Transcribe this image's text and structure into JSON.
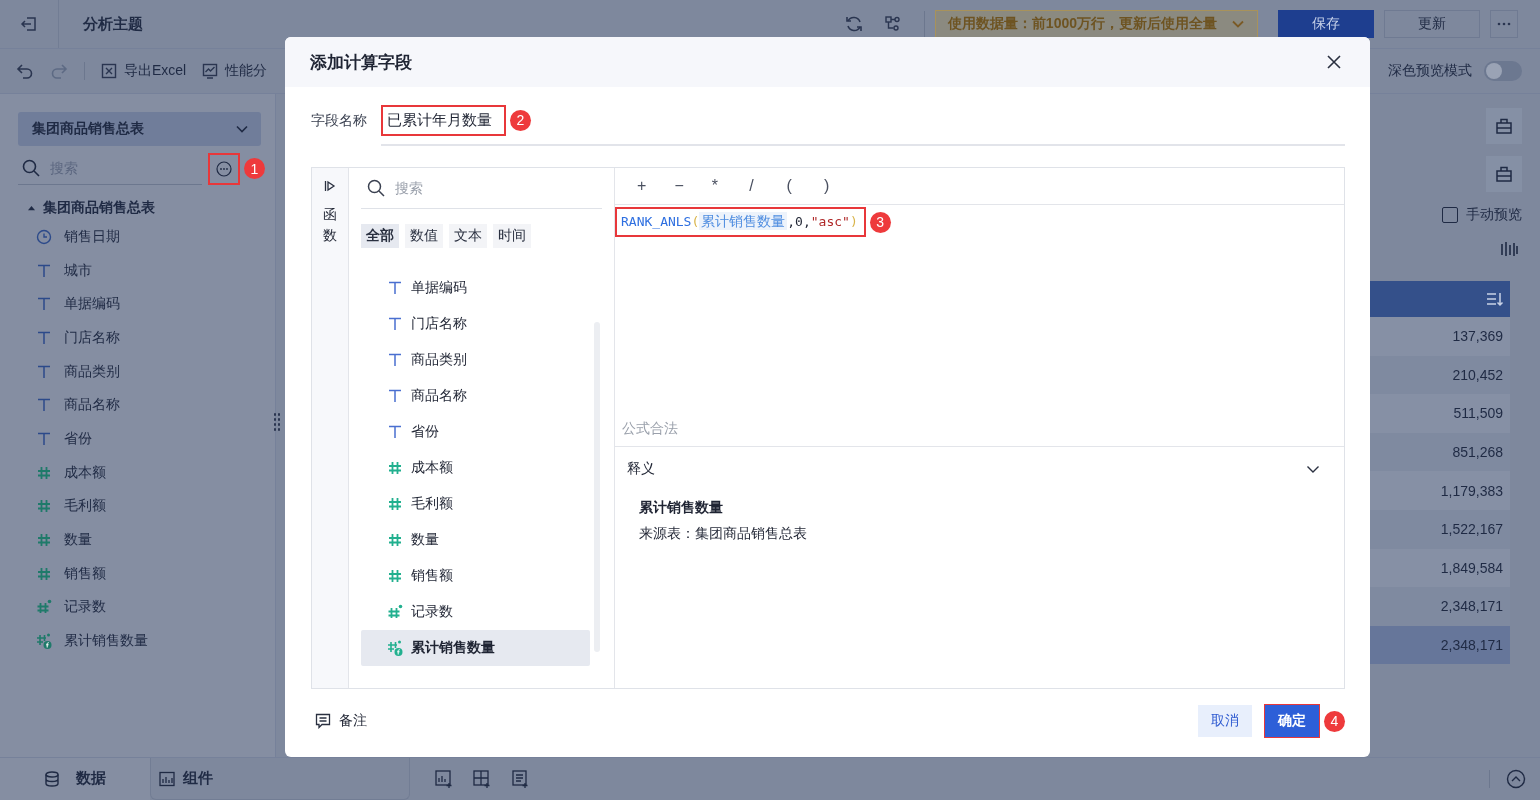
{
  "topbar": {
    "title": "分析主题",
    "data_notice": "使用数据量：前1000万行，更新后使用全量",
    "buttons": [
      {
        "label": "保存",
        "kind": "primary"
      },
      {
        "label": "更新",
        "kind": "default"
      }
    ]
  },
  "toolbar": {
    "items": [
      {
        "label": "导出Excel",
        "kind": "excel"
      },
      {
        "label": "性能分",
        "kind": "performance"
      }
    ],
    "dark_preview": {
      "label": "深色预览模式",
      "on": false
    }
  },
  "left_panel": {
    "dataset": "集团商品销售总表",
    "search": {
      "placeholder": "搜索"
    },
    "tree": {
      "label": "集团商品销售总表",
      "expanded": true,
      "children": [
        {
          "label": "销售日期",
          "kind": "date"
        },
        {
          "label": "城市",
          "kind": "text"
        },
        {
          "label": "单据编码",
          "kind": "text"
        },
        {
          "label": "门店名称",
          "kind": "text"
        },
        {
          "label": "商品类别",
          "kind": "text"
        },
        {
          "label": "商品名称",
          "kind": "text"
        },
        {
          "label": "省份",
          "kind": "text"
        },
        {
          "label": "成本额",
          "kind": "number"
        },
        {
          "label": "毛利额",
          "kind": "number"
        },
        {
          "label": "数量",
          "kind": "number"
        },
        {
          "label": "销售额",
          "kind": "number"
        },
        {
          "label": "记录数",
          "kind": "record"
        },
        {
          "label": "累计销售数量",
          "kind": "calc"
        }
      ]
    }
  },
  "right_panel": {
    "manual_preview": {
      "label": "手动预览",
      "checked": false
    },
    "table": {
      "rows": [
        {
          "value": "137,369",
          "selected": false
        },
        {
          "value": "210,452",
          "selected": false
        },
        {
          "value": "511,509",
          "selected": false
        },
        {
          "value": "851,268",
          "selected": false
        },
        {
          "value": "1,179,383",
          "selected": false
        },
        {
          "value": "1,522,167",
          "selected": false
        },
        {
          "value": "1,849,584",
          "selected": false
        },
        {
          "value": "2,348,171",
          "selected": false
        },
        {
          "value": "2,348,171",
          "selected": true
        }
      ]
    }
  },
  "bottom_bar": {
    "tabs": [
      {
        "label": "数据",
        "kind": "data",
        "selected": true
      },
      {
        "label": "组件",
        "kind": "widget",
        "selected": false
      }
    ]
  },
  "dialog": {
    "title": "添加计算字段",
    "field_name": {
      "label": "字段名称",
      "value": "已累计年月数量"
    },
    "side_tab": "函数",
    "field_search": {
      "placeholder": "搜索"
    },
    "filters": [
      {
        "label": "全部",
        "selected": true
      },
      {
        "label": "数值",
        "selected": false
      },
      {
        "label": "文本",
        "selected": false
      },
      {
        "label": "时间",
        "selected": false
      }
    ],
    "fields": [
      {
        "label": "单据编码",
        "kind": "text",
        "selected": false
      },
      {
        "label": "门店名称",
        "kind": "text",
        "selected": false
      },
      {
        "label": "商品类别",
        "kind": "text",
        "selected": false
      },
      {
        "label": "商品名称",
        "kind": "text",
        "selected": false
      },
      {
        "label": "省份",
        "kind": "text",
        "selected": false
      },
      {
        "label": "成本额",
        "kind": "number",
        "selected": false
      },
      {
        "label": "毛利额",
        "kind": "number",
        "selected": false
      },
      {
        "label": "数量",
        "kind": "number",
        "selected": false
      },
      {
        "label": "销售额",
        "kind": "number",
        "selected": false
      },
      {
        "label": "记录数",
        "kind": "record",
        "selected": false
      },
      {
        "label": "累计销售数量",
        "kind": "calc",
        "selected": true
      }
    ],
    "operators": [
      "+",
      "−",
      "*",
      "/",
      "(",
      ")"
    ],
    "formula": [
      {
        "text": "RANK_ANLS",
        "kind": "function"
      },
      {
        "text": "(",
        "kind": "paren"
      },
      {
        "text": "累计销售数量",
        "kind": "field"
      },
      {
        "text": ",0,",
        "kind": "plain"
      },
      {
        "text": "\"asc\"",
        "kind": "string"
      },
      {
        "text": ")",
        "kind": "paren"
      }
    ],
    "status": "公式合法",
    "definition": {
      "title": "释义",
      "expanded": true,
      "name": "累计销售数量",
      "source": "来源表：集团商品销售总表"
    },
    "note": "备注",
    "buttons": [
      {
        "label": "取消",
        "kind": "secondary"
      },
      {
        "label": "确定",
        "kind": "primary"
      }
    ]
  },
  "annotations": [
    "1",
    "2",
    "3",
    "4"
  ]
}
